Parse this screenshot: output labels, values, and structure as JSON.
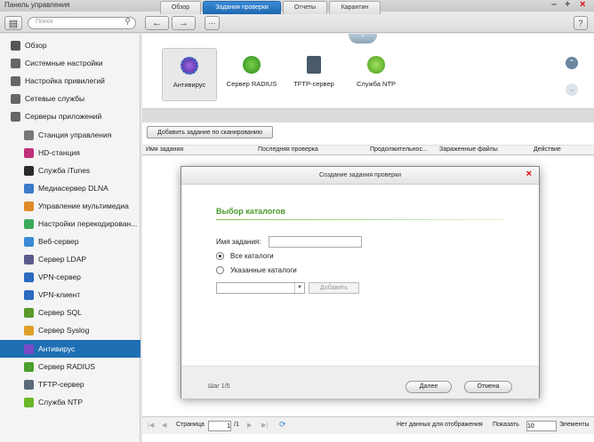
{
  "window": {
    "title": "Панель управления"
  },
  "toolbar": {
    "search_placeholder": "Поиск"
  },
  "sidebar": {
    "items": [
      {
        "label": "Обзор",
        "icon": "overview-icon",
        "color": "#555555"
      },
      {
        "label": "Системные настройки",
        "icon": "gear-icon",
        "color": "#666666"
      },
      {
        "label": "Настройка привилегий",
        "icon": "user-icon",
        "color": "#666666"
      },
      {
        "label": "Сетевые службы",
        "icon": "globe-icon",
        "color": "#666666"
      },
      {
        "label": "Серверы приложений",
        "icon": "apps-icon",
        "color": "#666666"
      },
      {
        "label": "Станция управления",
        "icon": "station-icon",
        "color": "#777777"
      },
      {
        "label": "HD-станция",
        "icon": "hd-station-icon",
        "color": "#c0307a"
      },
      {
        "label": "Служба iTunes",
        "icon": "itunes-icon",
        "color": "#2a2a2a"
      },
      {
        "label": "Медиасервер DLNA",
        "icon": "dlna-icon",
        "color": "#3a7ac8"
      },
      {
        "label": "Управление мультимедиа",
        "icon": "multimedia-icon",
        "color": "#e08a2a"
      },
      {
        "label": "Настройки перекодирован...",
        "icon": "transcode-icon",
        "color": "#3aaa5a"
      },
      {
        "label": "Веб-сервер",
        "icon": "web-server-icon",
        "color": "#3a8ad6"
      },
      {
        "label": "Сервер LDAP",
        "icon": "ldap-icon",
        "color": "#5a5a8a"
      },
      {
        "label": "VPN-сервер",
        "icon": "vpn-server-icon",
        "color": "#2a6ac0"
      },
      {
        "label": "VPN-клиент",
        "icon": "vpn-client-icon",
        "color": "#2a6ac0"
      },
      {
        "label": "Сервер SQL",
        "icon": "sql-icon",
        "color": "#5a9a2a"
      },
      {
        "label": "Сервер Syslog",
        "icon": "syslog-icon",
        "color": "#e0a02a"
      },
      {
        "label": "Антивирус",
        "icon": "antivirus-icon",
        "color": "#7a4ac8"
      },
      {
        "label": "Сервер RADIUS",
        "icon": "radius-icon",
        "color": "#4aa02a"
      },
      {
        "label": "TFTP-сервер",
        "icon": "tftp-icon",
        "color": "#5a6a7a"
      },
      {
        "label": "Служба NTP",
        "icon": "ntp-icon",
        "color": "#6ab82a"
      }
    ],
    "selected_index": 17
  },
  "apps": [
    {
      "label": "Антивирус",
      "icon": "antivirus-icon",
      "color": "#7a4ac8"
    },
    {
      "label": "Сервер RADIUS",
      "icon": "radius-icon",
      "color": "#4aa02a"
    },
    {
      "label": "TFTP-сервер",
      "icon": "tftp-icon",
      "color": "#5a6a7a"
    },
    {
      "label": "Служба NTP",
      "icon": "ntp-icon",
      "color": "#6ab82a"
    }
  ],
  "tabs": [
    "Обзор",
    "Задания проверки",
    "Отчеты",
    "Карантин"
  ],
  "actions": {
    "add_scan_job": "Добавить задание по сканированию"
  },
  "table": {
    "columns": [
      "Имя задания",
      "Последняя проверка",
      "Продолжительнос...",
      "Зараженные файлы",
      "Действие"
    ]
  },
  "pager": {
    "page_label": "Страница",
    "page_value": "1",
    "page_total": "/1",
    "no_data": "Нет данных для отображения",
    "show_label": "Показать",
    "show_value": "10",
    "items_label": "Элементы"
  },
  "dialog": {
    "title": "Создание задания проверки",
    "section_title": "Выбор каталогов",
    "job_name_label": "Имя задания:",
    "job_name_value": "",
    "radio_all": "Все каталоги",
    "radio_specified": "Указанные каталоги",
    "add_label": "Добавить",
    "step": "Шаг 1/5",
    "next_label": "Далее",
    "cancel_label": "Отмена"
  },
  "colors": {
    "accent": "#1f6fb4",
    "green": "#4a9a2a",
    "close": "#dd0000"
  }
}
